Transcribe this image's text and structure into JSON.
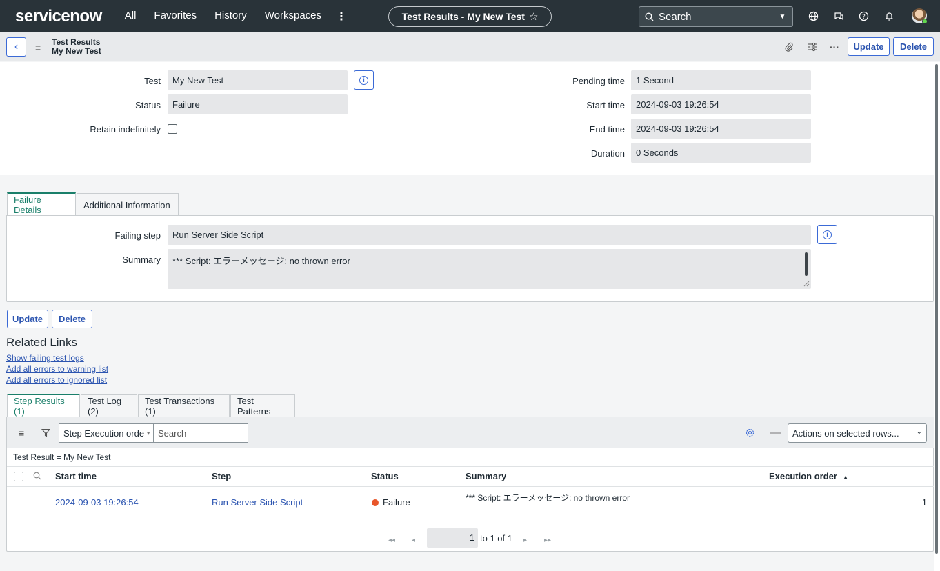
{
  "nav": {
    "logo_text": "servicenow",
    "links": [
      "All",
      "Favorites",
      "History",
      "Workspaces"
    ],
    "more": "⋮",
    "context_title": "Test Results - My New Test",
    "search_placeholder": "Search"
  },
  "header": {
    "title_line1": "Test Results",
    "title_line2": "My New Test",
    "update_label": "Update",
    "delete_label": "Delete"
  },
  "form": {
    "test_label": "Test",
    "test_value": "My New Test",
    "status_label": "Status",
    "status_value": "Failure",
    "retain_label": "Retain indefinitely",
    "pending_label": "Pending time",
    "pending_value": "1 Second",
    "start_label": "Start time",
    "start_value": "2024-09-03 19:26:54",
    "end_label": "End time",
    "end_value": "2024-09-03 19:26:54",
    "duration_label": "Duration",
    "duration_value": "0 Seconds"
  },
  "section_tabs": [
    "Failure Details",
    "Additional Information"
  ],
  "failure": {
    "failing_step_label": "Failing step",
    "failing_step_value": "Run Server Side Script",
    "summary_label": "Summary",
    "summary_value": "*** Script: エラーメッセージ: no thrown error"
  },
  "bottom_buttons": {
    "update_label": "Update",
    "delete_label": "Delete"
  },
  "related_links": {
    "title": "Related Links",
    "links": [
      "Show failing test logs",
      "Add all errors to warning list",
      "Add all errors to ignored list"
    ]
  },
  "list_tabs": [
    "Step Results (1)",
    "Test Log (2)",
    "Test Transactions (1)",
    "Test Patterns"
  ],
  "list": {
    "field_select": "Step Execution orde",
    "search_placeholder": "Search",
    "actions_select": "Actions on selected rows...",
    "breadcrumb": "Test Result = My New Test",
    "columns": [
      "Start time",
      "Step",
      "Status",
      "Summary",
      "Execution order"
    ],
    "sort_indicator": "▲",
    "rows": [
      {
        "start_time": "2024-09-03 19:26:54",
        "step": "Run Server Side Script",
        "status": "Failure",
        "summary": "*** Script: エラーメッセージ: no thrown error",
        "order": "1"
      }
    ],
    "pager_current": "1",
    "pager_text": "to 1 of 1"
  },
  "colors": {
    "nav_bg": "#293339",
    "accent_blue": "#2b54b0",
    "active_tab": "#1a7f6a",
    "failure_dot": "#e8562a",
    "logo_green": "#62d84e"
  }
}
